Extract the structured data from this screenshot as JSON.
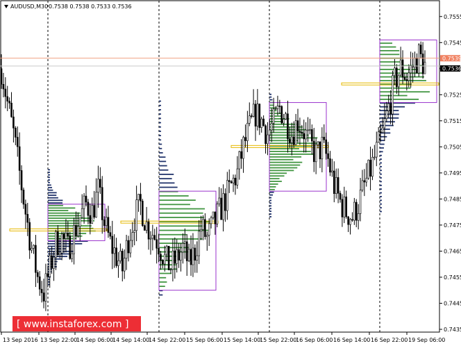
{
  "window": {
    "symbol_line": "AUDUSD,M30",
    "ohlc_line": "0.7538 0.7538 0.7533 0.7536"
  },
  "price_boxes": {
    "current_line": "0.7539",
    "last_price": "0.7536"
  },
  "watermark": {
    "text": "[ www.instaforex.com ]"
  },
  "colors": {
    "background": "#ffffff",
    "candle": "#000000",
    "grid_vline": "#000000",
    "profile_light": "#2e8b2e",
    "profile_dark": "#0b1f5c",
    "value_area_box": "#9932cc",
    "poc_line": "#e6b800",
    "current_price_line": "#f0a080",
    "last_price_box": "#000000",
    "watermark_bg": "#ec1c24"
  },
  "chart_data": {
    "type": "candlestick",
    "title": "AUDUSD,M30",
    "ylim": [
      0.7435,
      0.756
    ],
    "y_ticks": [
      "0.7555",
      "0.7545",
      "0.7535",
      "0.7525",
      "0.7515",
      "0.7505",
      "0.7495",
      "0.7485",
      "0.7475",
      "0.7465",
      "0.7455",
      "0.7445",
      "0.7435"
    ],
    "x_ticks": [
      "13 Sep 2016",
      "13 Sep 22:00",
      "14 Sep 06:00",
      "14 Sep 14:00",
      "14 Sep 22:00",
      "15 Sep 06:00",
      "15 Sep 14:00",
      "15 Sep 22:00",
      "16 Sep 06:00",
      "16 Sep 14:00",
      "16 Sep 22:00",
      "19 Sep 06:00"
    ],
    "session_separators": [
      "13 Sep 22:00",
      "14 Sep 22:00",
      "15 Sep 22:00",
      "16 Sep 22:00"
    ],
    "horizontal_lines": [
      {
        "value": 0.7539,
        "role": "current"
      },
      {
        "value": 0.7536,
        "role": "last"
      }
    ],
    "close_path": [
      [
        0,
        0.7535
      ],
      [
        3,
        0.7522
      ],
      [
        6,
        0.751
      ],
      [
        9,
        0.7495
      ],
      [
        12,
        0.748
      ],
      [
        15,
        0.7466
      ],
      [
        18,
        0.7455
      ],
      [
        21,
        0.7449
      ],
      [
        24,
        0.7458
      ],
      [
        27,
        0.7468
      ],
      [
        30,
        0.747
      ],
      [
        33,
        0.7466
      ],
      [
        36,
        0.7472
      ],
      [
        39,
        0.7478
      ],
      [
        42,
        0.7483
      ],
      [
        45,
        0.748
      ],
      [
        48,
        0.7488
      ],
      [
        51,
        0.7476
      ],
      [
        54,
        0.7468
      ],
      [
        57,
        0.7463
      ],
      [
        60,
        0.7458
      ],
      [
        63,
        0.747
      ],
      [
        66,
        0.7478
      ],
      [
        69,
        0.7483
      ],
      [
        72,
        0.7475
      ],
      [
        75,
        0.7472
      ],
      [
        78,
        0.7468
      ],
      [
        81,
        0.7462
      ],
      [
        84,
        0.7459
      ],
      [
        87,
        0.7462
      ],
      [
        90,
        0.7466
      ],
      [
        93,
        0.746
      ],
      [
        96,
        0.7465
      ],
      [
        99,
        0.7474
      ],
      [
        102,
        0.747
      ],
      [
        105,
        0.7475
      ],
      [
        108,
        0.748
      ],
      [
        111,
        0.7485
      ],
      [
        114,
        0.749
      ],
      [
        117,
        0.7495
      ],
      [
        120,
        0.7505
      ],
      [
        123,
        0.7512
      ],
      [
        126,
        0.7518
      ],
      [
        129,
        0.7515
      ],
      [
        132,
        0.751
      ],
      [
        135,
        0.7514
      ],
      [
        138,
        0.752
      ],
      [
        141,
        0.7516
      ],
      [
        144,
        0.751
      ],
      [
        147,
        0.7515
      ],
      [
        150,
        0.7511
      ],
      [
        153,
        0.7506
      ],
      [
        156,
        0.7502
      ],
      [
        159,
        0.7505
      ],
      [
        162,
        0.75
      ],
      [
        165,
        0.749
      ],
      [
        168,
        0.7484
      ],
      [
        171,
        0.748
      ],
      [
        174,
        0.7478
      ],
      [
        177,
        0.7483
      ],
      [
        180,
        0.749
      ],
      [
        183,
        0.7496
      ],
      [
        186,
        0.7503
      ],
      [
        189,
        0.751
      ],
      [
        192,
        0.752
      ],
      [
        195,
        0.753
      ],
      [
        198,
        0.7535
      ],
      [
        201,
        0.7532
      ],
      [
        204,
        0.7536
      ],
      [
        207,
        0.754
      ],
      [
        210,
        0.7536
      ]
    ]
  }
}
